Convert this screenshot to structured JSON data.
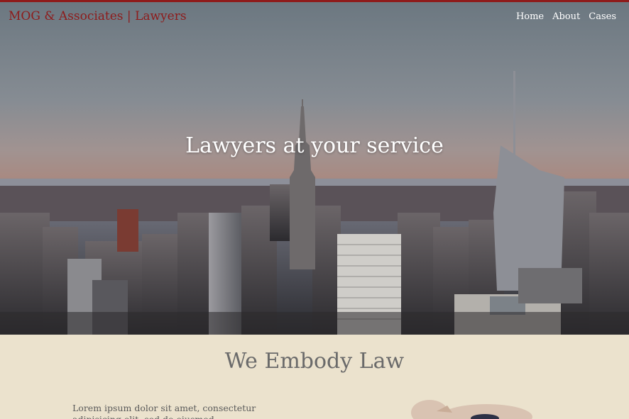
{
  "brand": "MOG & Associates | Lawyers",
  "nav": {
    "items": [
      "Home",
      "About",
      "Cases"
    ]
  },
  "hero": {
    "title": "Lawyers at your service"
  },
  "section": {
    "title": "We Embody Law",
    "text": "Lorem ipsum dolor sit amet, consectetur adipisicing elit, sed do eiusmod"
  },
  "colors": {
    "accent": "#8e1b1b",
    "section_bg": "#ebe2cd",
    "heading": "#6a6a6a"
  }
}
